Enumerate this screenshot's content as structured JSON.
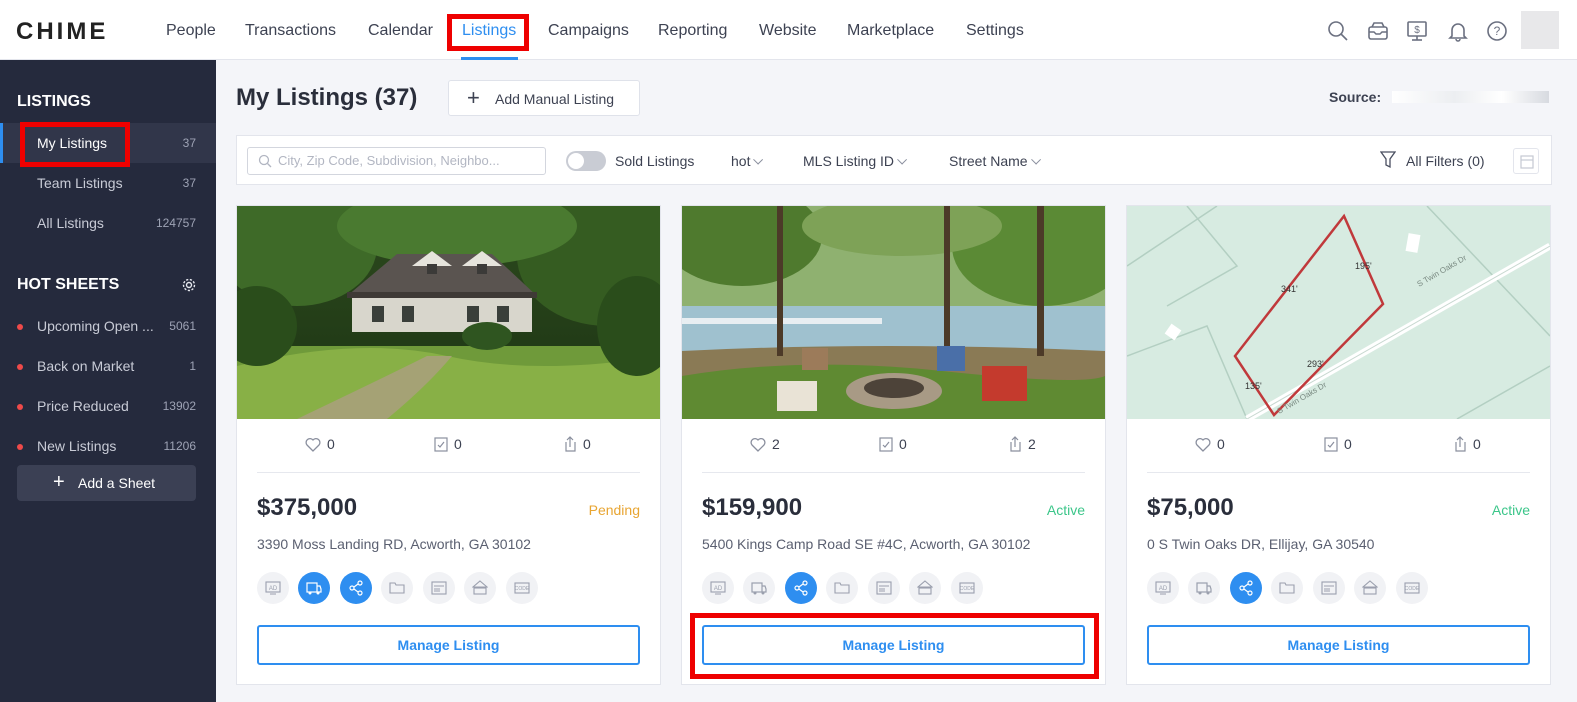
{
  "app": {
    "logo": "CHIME"
  },
  "nav": [
    "People",
    "Transactions",
    "Calendar",
    "Listings",
    "Campaigns",
    "Reporting",
    "Website",
    "Marketplace",
    "Settings"
  ],
  "colors": {
    "accent": "#2e8ef0",
    "sidebar": "#252a3d",
    "pending": "#e8a532",
    "active": "#3cc68a",
    "highlight": "#ee0000"
  },
  "sidebar": {
    "listings_heading": "LISTINGS",
    "listings": [
      {
        "label": "My Listings",
        "count": "37"
      },
      {
        "label": "Team Listings",
        "count": "37"
      },
      {
        "label": "All Listings",
        "count": "124757"
      }
    ],
    "hot_sheets_heading": "HOT SHEETS",
    "hot_sheets": [
      {
        "label": "Upcoming Open ...",
        "count": "5061"
      },
      {
        "label": "Back on Market",
        "count": "1"
      },
      {
        "label": "Price Reduced",
        "count": "13902"
      },
      {
        "label": "New Listings",
        "count": "11206"
      }
    ],
    "add_sheet_label": "Add a Sheet"
  },
  "header": {
    "title": "My Listings (37)",
    "add_manual_label": "Add Manual Listing",
    "source_label": "Source:"
  },
  "filters": {
    "search_placeholder": "City, Zip Code, Subdivision, Neighbo...",
    "sold_label": "Sold Listings",
    "hot_label": "hot",
    "mls_label": "MLS Listing ID",
    "street_label": "Street Name",
    "all_filters_label": "All Filters (0)"
  },
  "listings": [
    {
      "price": "$375,000",
      "status": "Pending",
      "address": "3390 Moss Landing RD, Acworth, GA 30102",
      "likes": "0",
      "saves": "0",
      "shares": "0",
      "manage_label": "Manage Listing"
    },
    {
      "price": "$159,900",
      "status": "Active",
      "address": "5400 Kings Camp Road SE #4C, Acworth, GA 30102",
      "likes": "2",
      "saves": "0",
      "shares": "2",
      "manage_label": "Manage Listing"
    },
    {
      "price": "$75,000",
      "status": "Active",
      "address": "0 S Twin Oaks DR, Ellijay, GA 30540",
      "likes": "0",
      "saves": "0",
      "shares": "0",
      "manage_label": "Manage Listing"
    }
  ],
  "map_labels": {
    "north": "195'",
    "west": "341'",
    "east": "293'",
    "south": "135'",
    "road_upper": "S Twin Oaks Dr",
    "road_lower": "S Twin Oaks Dr"
  },
  "tool_icons": [
    "ad-icon",
    "truck-icon",
    "share-icon",
    "folder-icon",
    "flyer-icon",
    "sign-icon",
    "code-icon"
  ]
}
